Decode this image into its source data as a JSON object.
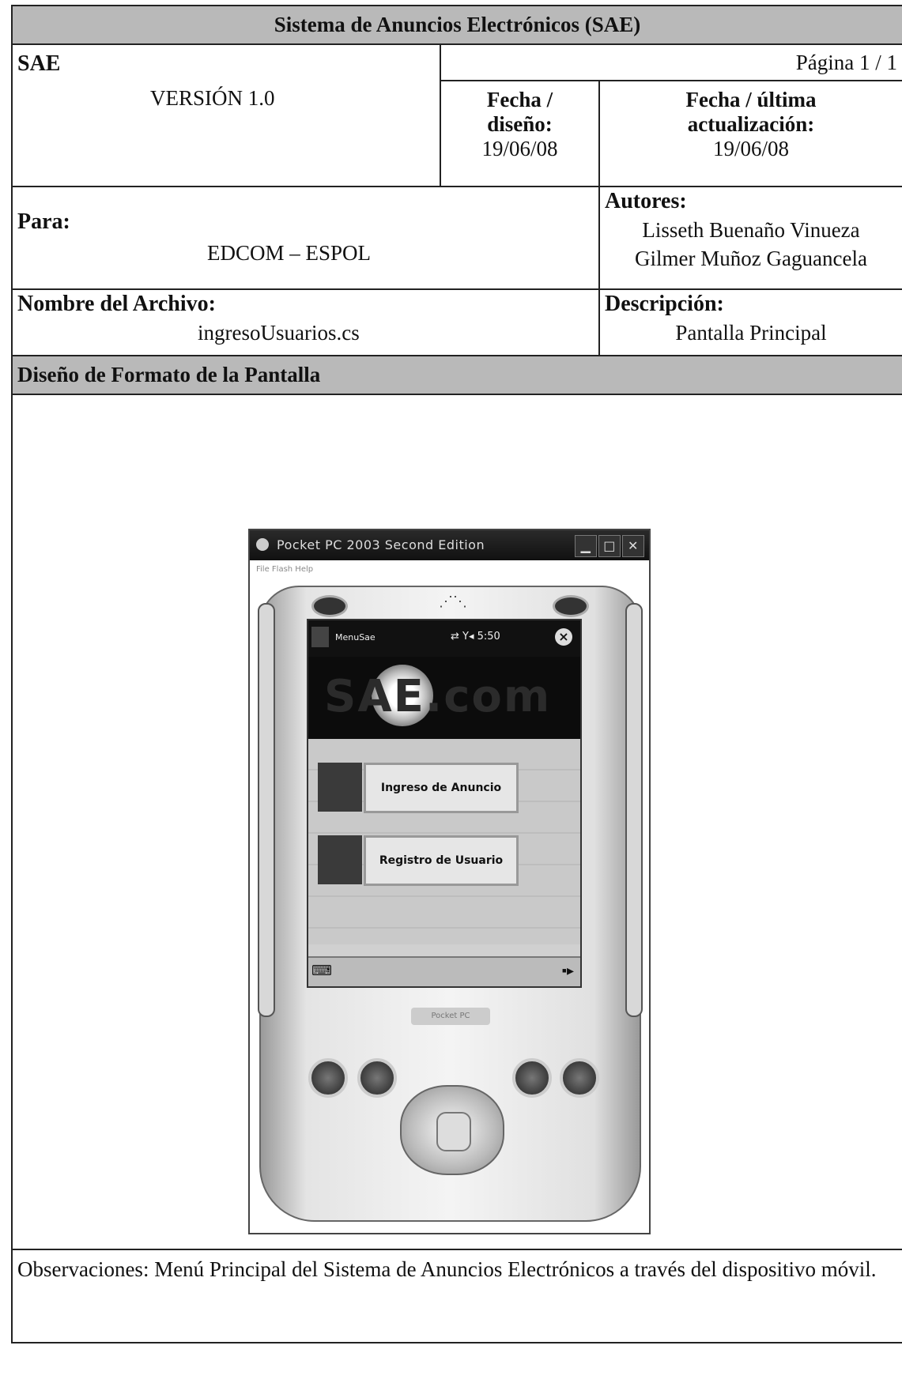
{
  "header": {
    "title": "Sistema de Anuncios Electrónicos (SAE)",
    "system_code": "SAE",
    "version": "VERSIÓN 1.0",
    "page": "Página  1 / 1",
    "design_date_label": "Fecha / diseño:",
    "design_date": "19/06/08",
    "update_date_label": "Fecha / última actualización:",
    "update_date": "19/06/08"
  },
  "info": {
    "para_label": "Para:",
    "para_value": "EDCOM – ESPOL",
    "autores_label": "Autores:",
    "autores": [
      "Lisseth Buenaño Vinueza",
      "Gilmer Muñoz Gaguancela"
    ],
    "archivo_label": "Nombre del Archivo:",
    "archivo_value": "ingresoUsuarios.cs",
    "descripcion_label": "Descripción:",
    "descripcion_value": "Pantalla Principal"
  },
  "section_title": "Diseño de Formato de la Pantalla",
  "emulator": {
    "window_title": "Pocket PC 2003 Second Edition",
    "menu": "File  Flash  Help",
    "app_name": "MenuSae",
    "status_icons": "⇄ Y◂ 5:50",
    "banner_text": "SAE.com",
    "buttons": [
      {
        "label": "Ingreso de Anuncio"
      },
      {
        "label": "Registro de Usuario"
      }
    ],
    "brand": "Pocket PC"
  },
  "observaciones": "Observaciones: Menú Principal del Sistema de Anuncios Electrónicos a través del dispositivo móvil."
}
